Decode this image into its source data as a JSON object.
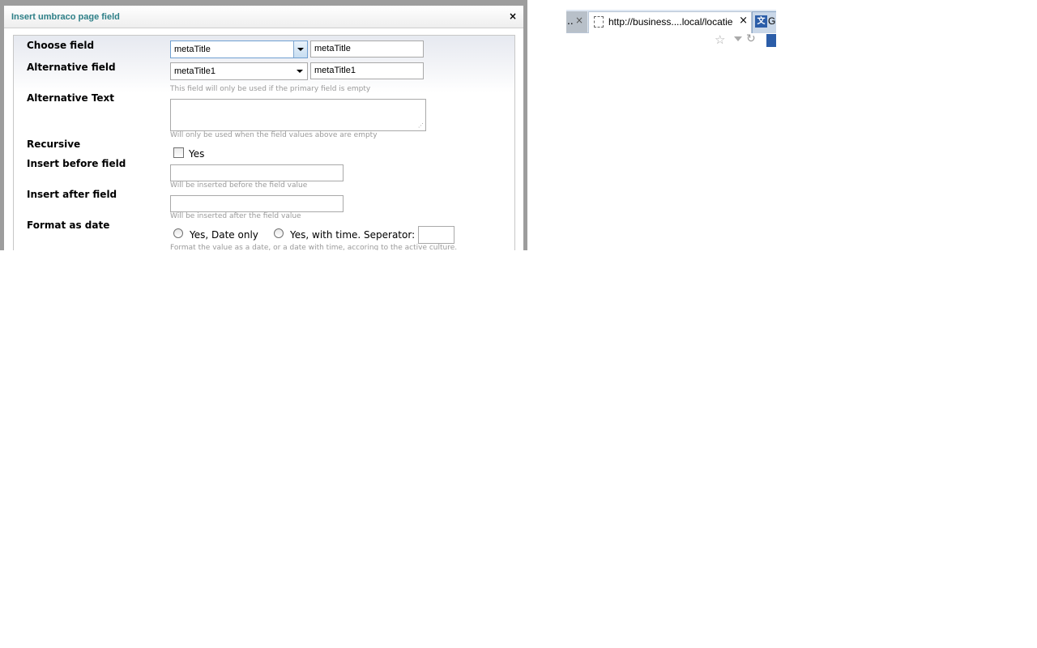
{
  "dialog": {
    "title": "Insert umbraco page field",
    "close_symbol": "×"
  },
  "form": {
    "choose_field": {
      "label": "Choose field",
      "select_value": "metaTitle",
      "text_value": "metaTitle"
    },
    "alternative_field": {
      "label": "Alternative field",
      "select_value": "metaTitle1",
      "text_value": "metaTitle1",
      "hint": "This field will only be used if the primary field is empty"
    },
    "alternative_text": {
      "label": "Alternative Text",
      "value": "",
      "hint": "Will only be used when the field values above are empty"
    },
    "recursive": {
      "label": "Recursive",
      "option": "Yes",
      "checked": false
    },
    "insert_before": {
      "label": "Insert before field",
      "value": "",
      "hint": "Will be inserted before the field value"
    },
    "insert_after": {
      "label": "Insert after field",
      "value": "",
      "hint": "Will be inserted after the field value"
    },
    "format_date": {
      "label": "Format as date",
      "option_date_only": "Yes, Date only",
      "option_with_time": "Yes, with time. Seperator: :",
      "separator_value": "",
      "hint": "Format the value as a date, or a date with time, accoring to the active culture."
    }
  },
  "browser": {
    "prev_tab_text": "..",
    "active_tab_url": "http://business....local/locatie",
    "next_tab_text": "G",
    "tab_close": "×",
    "icons": [
      "page-icon",
      "translate-icon",
      "star-icon",
      "dropdown-icon",
      "reload-icon"
    ]
  },
  "colors": {
    "title": "#2d7f87",
    "hint": "#9a9a9a",
    "dialog_frame": "#9d9d9d"
  }
}
